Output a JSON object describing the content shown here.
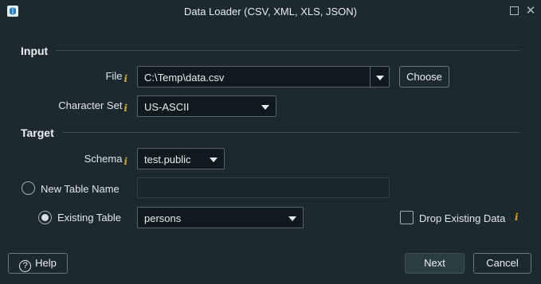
{
  "window": {
    "title": "Data Loader (CSV, XML, XLS, JSON)",
    "icons": {
      "app": "app-icon",
      "maximize": "maximize-icon",
      "close": "close-icon"
    }
  },
  "input_section": {
    "title": "Input",
    "file": {
      "label": "File",
      "info_icon": "i",
      "value": "C:\\Temp\\data.csv",
      "choose_label": "Choose"
    },
    "charset": {
      "label": "Character Set",
      "info_icon": "i",
      "value": "US-ASCII"
    }
  },
  "target_section": {
    "title": "Target",
    "schema": {
      "label": "Schema",
      "info_icon": "i",
      "value": "test.public"
    },
    "new_table": {
      "label": "New Table Name",
      "value": "",
      "selected": false
    },
    "existing_table": {
      "label": "Existing Table",
      "value": "persons",
      "selected": true
    },
    "drop_existing": {
      "label": "Drop Existing Data",
      "info_icon": "i",
      "checked": false
    }
  },
  "footer": {
    "help_label": "Help",
    "help_icon": "?",
    "next_label": "Next",
    "cancel_label": "Cancel"
  },
  "colors": {
    "background": "#1c2a30",
    "field": "#101a1e",
    "info": "#d4a92b",
    "border": "#55646a"
  }
}
